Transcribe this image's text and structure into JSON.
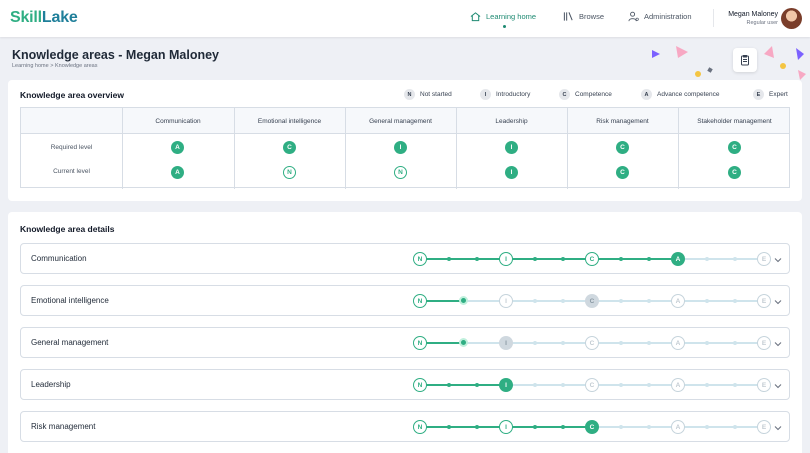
{
  "brand": {
    "part1": "Skill",
    "part2": "Lake"
  },
  "nav": {
    "learning_home": "Learning home",
    "browse": "Browse",
    "administration": "Administration"
  },
  "user": {
    "name": "Megan Maloney",
    "role": "Regular user"
  },
  "page": {
    "title": "Knowledge areas - Megan Maloney",
    "breadcrumb": "Learning home  >  Knowledge areas"
  },
  "overview": {
    "title": "Knowledge area overview",
    "legend": [
      {
        "letter": "N",
        "label": "Not started"
      },
      {
        "letter": "I",
        "label": "Introductory"
      },
      {
        "letter": "C",
        "label": "Competence"
      },
      {
        "letter": "A",
        "label": "Advance competence"
      },
      {
        "letter": "E",
        "label": "Expert"
      }
    ],
    "row_labels": {
      "required": "Required level",
      "current": "Current level"
    },
    "columns": [
      {
        "name": "Communication",
        "required": "A",
        "current": "A",
        "current_style": "filled"
      },
      {
        "name": "Emotional intelligence",
        "required": "C",
        "current": "N",
        "current_style": "outline"
      },
      {
        "name": "General management",
        "required": "I",
        "current": "N",
        "current_style": "outline"
      },
      {
        "name": "Leadership",
        "required": "I",
        "current": "I",
        "current_style": "filled"
      },
      {
        "name": "Risk management",
        "required": "C",
        "current": "C",
        "current_style": "filled"
      },
      {
        "name": "Stakeholder management",
        "required": "C",
        "current": "C",
        "current_style": "filled"
      }
    ]
  },
  "details": {
    "title": "Knowledge area details",
    "scale": [
      "N",
      "I",
      "C",
      "A",
      "E"
    ],
    "rows": [
      {
        "name": "Communication",
        "progress": 3,
        "required": 3
      },
      {
        "name": "Emotional intelligence",
        "progress": 0.5,
        "required": 2
      },
      {
        "name": "General management",
        "progress": 0.5,
        "required": 1
      },
      {
        "name": "Leadership",
        "progress": 1,
        "required": 1
      },
      {
        "name": "Risk management",
        "progress": 2,
        "required": 2
      }
    ]
  },
  "colors": {
    "accent": "#2fae83",
    "brand_dark": "#1f7f9a",
    "track": "#cfe4ec"
  }
}
